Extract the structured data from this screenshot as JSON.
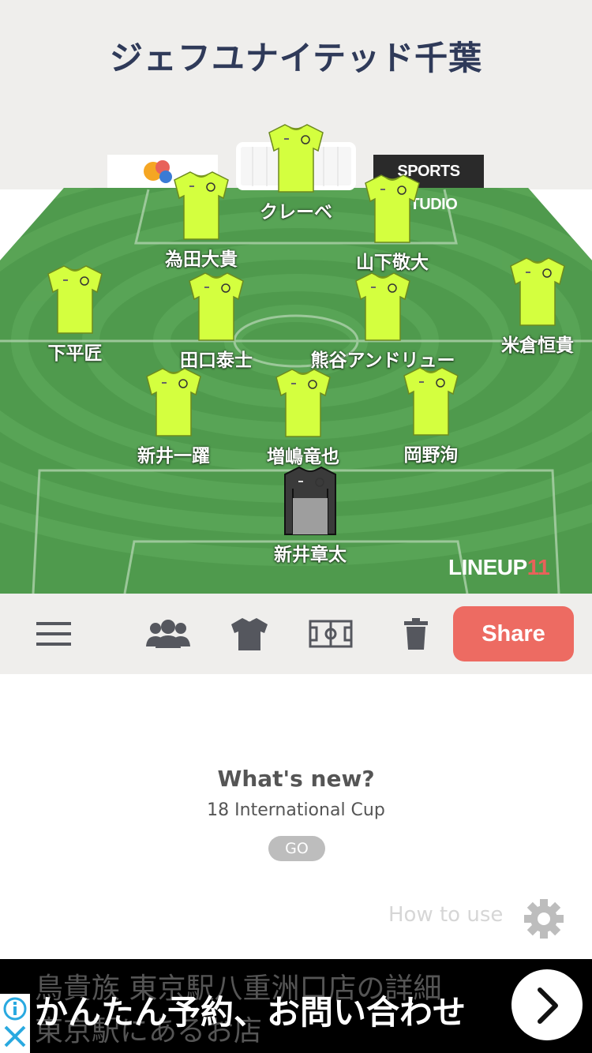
{
  "header": {
    "team_name": "ジェフユナイテッド千葉"
  },
  "sponsors": {
    "right_label": "SPORTS STUDIO"
  },
  "players": [
    {
      "name": "クレーベ",
      "kit": "outfield"
    },
    {
      "name": "為田大貴",
      "kit": "outfield"
    },
    {
      "name": "山下敬大",
      "kit": "outfield"
    },
    {
      "name": "下平匠",
      "kit": "outfield"
    },
    {
      "name": "田口泰士",
      "kit": "outfield"
    },
    {
      "name": "熊谷アンドリュー",
      "kit": "outfield"
    },
    {
      "name": "米倉恒貴",
      "kit": "outfield"
    },
    {
      "name": "新井一躍",
      "kit": "outfield"
    },
    {
      "name": "増嶋竜也",
      "kit": "outfield"
    },
    {
      "name": "岡野洵",
      "kit": "outfield"
    },
    {
      "name": "新井章太",
      "kit": "goalkeeper"
    }
  ],
  "brand": {
    "name": "LINEUP",
    "number": "11"
  },
  "toolbar": {
    "icons": [
      "menu-icon",
      "team-icon",
      "shirt-icon",
      "field-icon",
      "trash-icon"
    ],
    "share_label": "Share"
  },
  "whats_new": {
    "title": "What's new?",
    "text": "18 International Cup",
    "go_label": "GO"
  },
  "help": {
    "label": "How to use"
  },
  "ad": {
    "text": "かんたん予約、お問い合わせ",
    "background_line1": "鳥貴族 東京駅八重洲口店の詳細",
    "background_line2": "東京駅にあるお店"
  },
  "colors": {
    "outfield_kit": "#d4ff3f",
    "goalkeeper_kit": "#3a3a3a",
    "pitch": "#4f9a4d",
    "share_button": "#ed6b62",
    "title": "#2f3a59"
  }
}
